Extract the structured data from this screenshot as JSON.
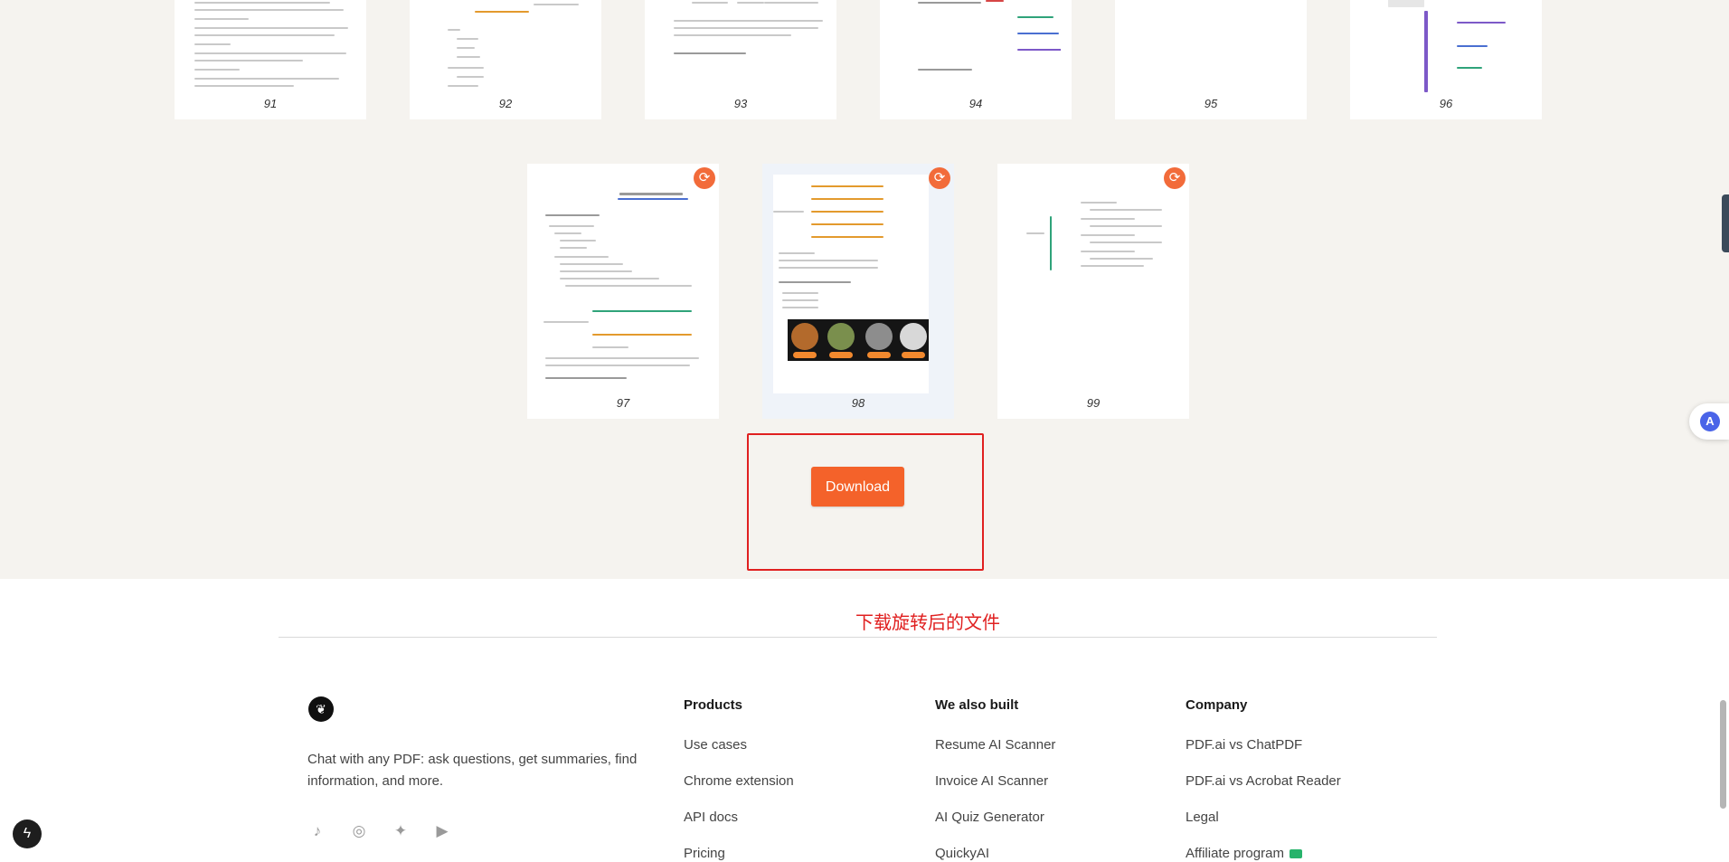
{
  "thumbnails_row1": [
    {
      "page": "91"
    },
    {
      "page": "92"
    },
    {
      "page": "93"
    },
    {
      "page": "94"
    },
    {
      "page": "95"
    },
    {
      "page": "96"
    }
  ],
  "thumbnails_row2": [
    {
      "page": "97",
      "rotate_icon": "rotate-icon"
    },
    {
      "page": "98",
      "rotate_icon": "rotate-icon"
    },
    {
      "page": "99",
      "rotate_icon": "rotate-icon"
    }
  ],
  "download": {
    "label": "Download"
  },
  "annotation": {
    "text": "下载旋转后的文件"
  },
  "footer": {
    "tagline": "Chat with any PDF: ask questions, get summaries, find information, and more.",
    "socials": [
      "tiktok-icon",
      "instagram-icon",
      "twitter-icon",
      "youtube-icon"
    ],
    "columns": {
      "products": {
        "heading": "Products",
        "links": [
          "Use cases",
          "Chrome extension",
          "API docs",
          "Pricing"
        ]
      },
      "also_built": {
        "heading": "We also built",
        "links": [
          "Resume AI Scanner",
          "Invoice AI Scanner",
          "AI Quiz Generator",
          "QuickyAI"
        ]
      },
      "company": {
        "heading": "Company",
        "links": [
          "PDF.ai vs ChatPDF",
          "PDF.ai vs Acrobat Reader",
          "Legal",
          "Affiliate program"
        ]
      }
    }
  },
  "colors": {
    "page_bg": "#f5f3ef",
    "accent": "#f4622a",
    "annotation_red": "#e02020"
  }
}
